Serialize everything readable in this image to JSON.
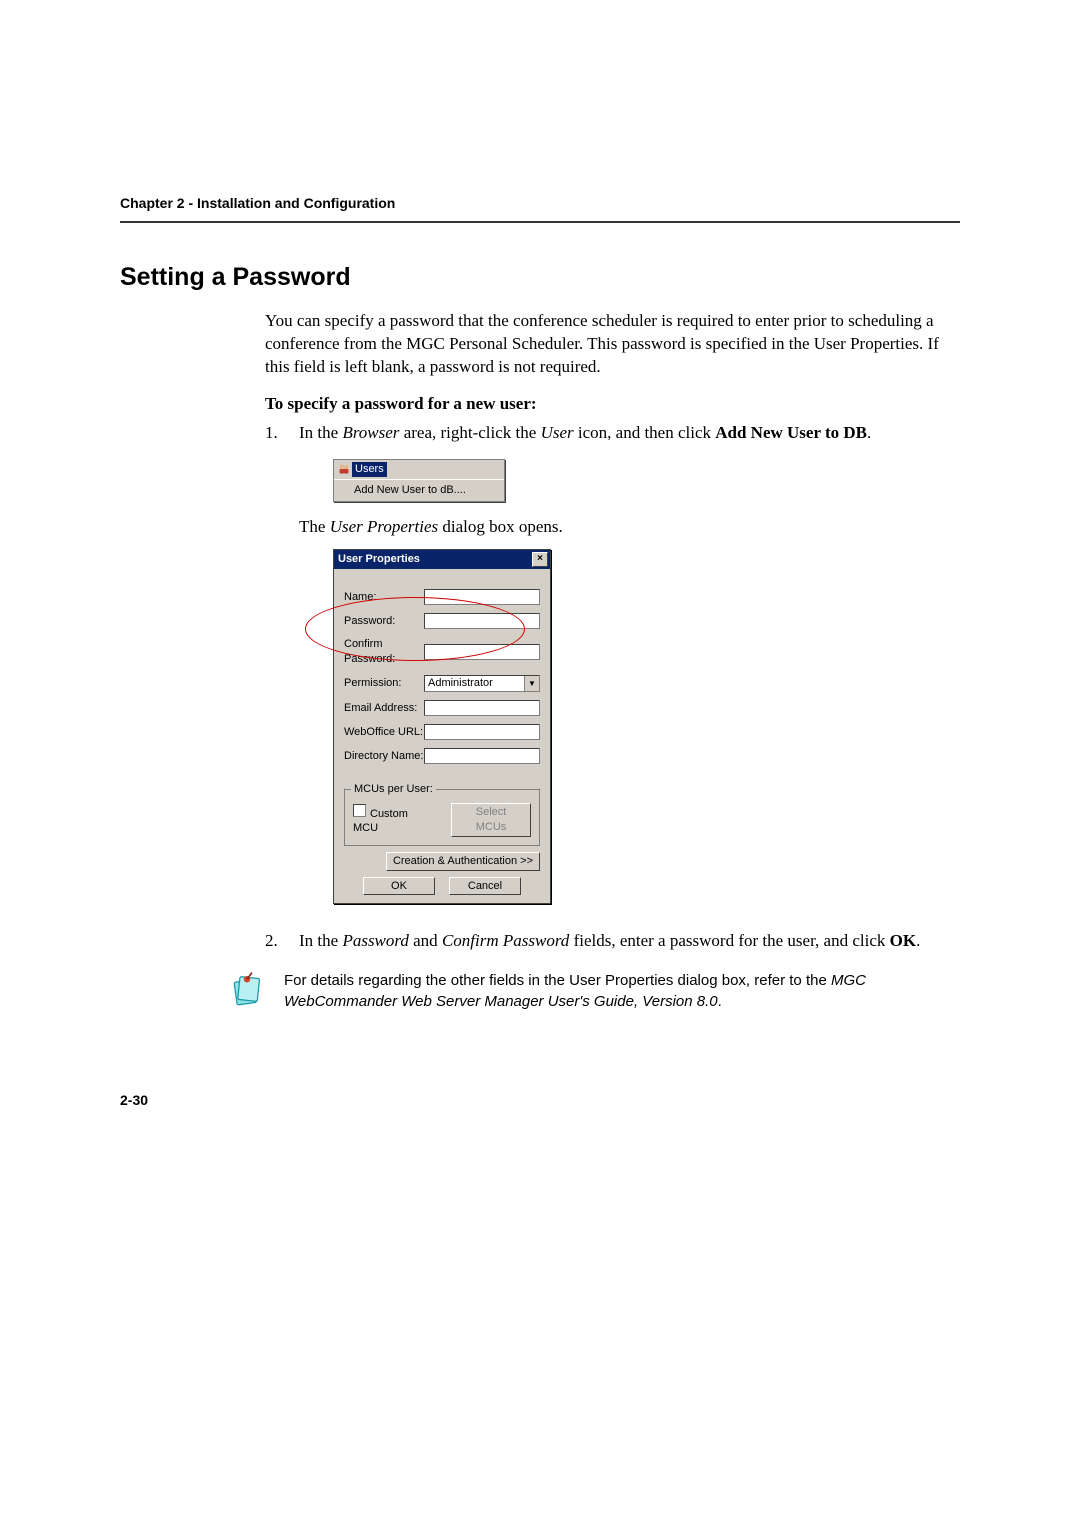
{
  "chapter_header": "Chapter 2 - Installation and Configuration",
  "section_title": "Setting a Password",
  "intro_para": "You can specify a password that the conference scheduler is required to enter prior to scheduling a conference from the MGC Personal Scheduler. This password is specified in the User Properties. If this field is left blank, a password is not required.",
  "subhead": "To specify a password for a new user:",
  "step1": {
    "num": "1.",
    "pre": "In the ",
    "em1": "Browser",
    "mid": " area, right-click the ",
    "em2": "User",
    "post": " icon, and then click ",
    "bold1": "Add New User to DB",
    "tail": "."
  },
  "ctx": {
    "title": "Users",
    "item": "Add New User to dB...."
  },
  "step1_after_pre": "The ",
  "step1_after_em": "User Properties",
  "step1_after_post": " dialog box opens.",
  "dlg": {
    "title": "User Properties",
    "labels": {
      "name": "Name:",
      "password": "Password:",
      "confirm": "Confirm Password:",
      "permission": "Permission:",
      "email": "Email Address:",
      "weboffice": "WebOffice URL:",
      "dirname": "Directory Name:"
    },
    "permission_value": "Administrator",
    "group_legend": "MCUs per User:",
    "custom_mcu": "Custom MCU",
    "select_mcus": "Select MCUs",
    "creation_auth": "Creation & Authentication >>",
    "ok": "OK",
    "cancel": "Cancel"
  },
  "step2": {
    "num": "2.",
    "pre": "In the ",
    "em1": "Password",
    "mid": " and ",
    "em2": "Confirm Password",
    "post": " fields, enter a password for the user, and click ",
    "bold1": "OK",
    "tail": "."
  },
  "note": {
    "pre": "For details regarding the other fields in the User Properties dialog box, refer to the ",
    "em": "MGC WebCommander Web Server Manager User's Guide, Version 8.0",
    "tail": "."
  },
  "page_num": "2-30"
}
